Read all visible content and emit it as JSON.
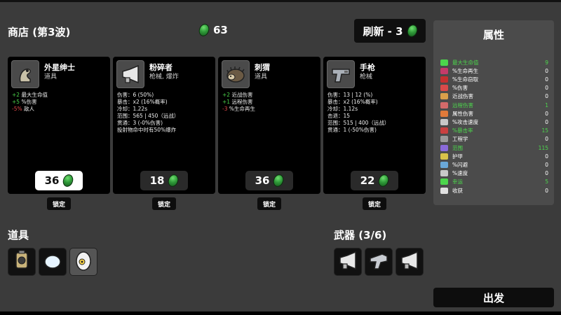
{
  "header": {
    "title": "商店 (第3波)",
    "gold": "63",
    "reroll_label": "刷新 - 3"
  },
  "cards": [
    {
      "name": "外星绅士",
      "kind": "道具",
      "price": "36",
      "icon": "alien-gentleman-icon",
      "stats": [
        {
          "prefix": "+2",
          "text": " 最大生命值"
        },
        {
          "prefix": "+5",
          "text": " %伤害"
        },
        {
          "prefix": "-5%",
          "text": " 敌人"
        }
      ]
    },
    {
      "name": "粉碎者",
      "kind": "枪械, 爆炸",
      "price": "18",
      "icon": "megaphone-gun-icon",
      "stats": [
        {
          "text": "伤害：6 (50%)"
        },
        {
          "text": "暴击：x2 (16%概率)"
        },
        {
          "text": "冷却：1.22s"
        },
        {
          "text": "范围：565 | 450（远战）"
        },
        {
          "text": "贯通：3 (-0%伤害)"
        },
        {
          "text": "投射物命中时有50%爆炸"
        }
      ]
    },
    {
      "name": "刺猬",
      "kind": "道具",
      "price": "36",
      "icon": "hedgehog-icon",
      "stats": [
        {
          "prefix": "+2",
          "text": " 近战伤害"
        },
        {
          "prefix": "+1",
          "text": " 远程伤害"
        },
        {
          "prefix": "-3",
          "text": " %生命再生"
        }
      ]
    },
    {
      "name": "手枪",
      "kind": "枪械",
      "price": "22",
      "icon": "pistol-icon",
      "stats": [
        {
          "text": "伤害：13 | 12 (%)"
        },
        {
          "text": "暴击：x2 (16%概率)"
        },
        {
          "text": "冷却：1.12s"
        },
        {
          "text": "击退：15"
        },
        {
          "text": "范围：515 | 400（远战）"
        },
        {
          "text": "贯通：1 (-50%伤害)"
        }
      ]
    }
  ],
  "lock_label": "锁定",
  "attributes": {
    "title": "属性",
    "items": [
      {
        "name": "最大生命值",
        "value": "9",
        "hl": true,
        "color": "#4cd64c"
      },
      {
        "name": "%生命再生",
        "value": "0",
        "hl": false,
        "color": "#c43b6a"
      },
      {
        "name": "%生命窃取",
        "value": "0",
        "hl": false,
        "color": "#c43030"
      },
      {
        "name": "%伤害",
        "value": "0",
        "hl": false,
        "color": "#d94a4a"
      },
      {
        "name": "近战伤害",
        "value": "0",
        "hl": false,
        "color": "#d9a04a"
      },
      {
        "name": "远程伤害",
        "value": "1",
        "hl": true,
        "color": "#d46a6a"
      },
      {
        "name": "属性伤害",
        "value": "0",
        "hl": false,
        "color": "#e07a3a"
      },
      {
        "name": "%攻击速度",
        "value": "0",
        "hl": false,
        "color": "#c8c8c8"
      },
      {
        "name": "%暴击率",
        "value": "15",
        "hl": true,
        "color": "#c94040"
      },
      {
        "name": "工程学",
        "value": "0",
        "hl": false,
        "color": "#9a9a9a"
      },
      {
        "name": "范围",
        "value": "115",
        "hl": true,
        "color": "#8a6ad9"
      },
      {
        "name": "护甲",
        "value": "0",
        "hl": false,
        "color": "#d9c24a"
      },
      {
        "name": "%闪避",
        "value": "0",
        "hl": false,
        "color": "#6aa8d9"
      },
      {
        "name": "%速度",
        "value": "0",
        "hl": false,
        "color": "#c8c8c8"
      },
      {
        "name": "幸运",
        "value": "5",
        "hl": true,
        "color": "#4cd64c"
      },
      {
        "name": "收获",
        "value": "0",
        "hl": false,
        "color": "#e0e0e0"
      }
    ]
  },
  "sections": {
    "items_label": "道具",
    "weapons_label": "武器 (3/6)"
  },
  "go_label": "出发"
}
